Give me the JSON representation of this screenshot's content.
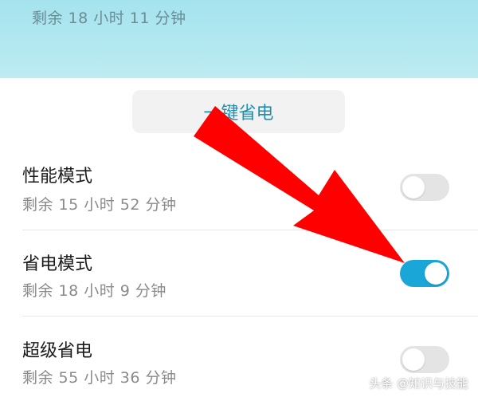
{
  "header": {
    "remaining": "剩余 18 小时 11 分钟"
  },
  "one_key_button": {
    "label": "一键省电"
  },
  "modes": [
    {
      "title": "性能模式",
      "remaining": "剩余 15 小时 52 分钟",
      "enabled": false
    },
    {
      "title": "省电模式",
      "remaining": "剩余 18 小时 9 分钟",
      "enabled": true
    },
    {
      "title": "超级省电",
      "remaining": "剩余 55 小时 36 分钟",
      "enabled": false
    }
  ],
  "watermark": "头条 @知识与技能",
  "colors": {
    "accent": "#1aa6d6",
    "arrow": "#ff0000",
    "header_bg": "#a4e3ee"
  },
  "annotation": {
    "icon": "red-arrow-icon"
  }
}
